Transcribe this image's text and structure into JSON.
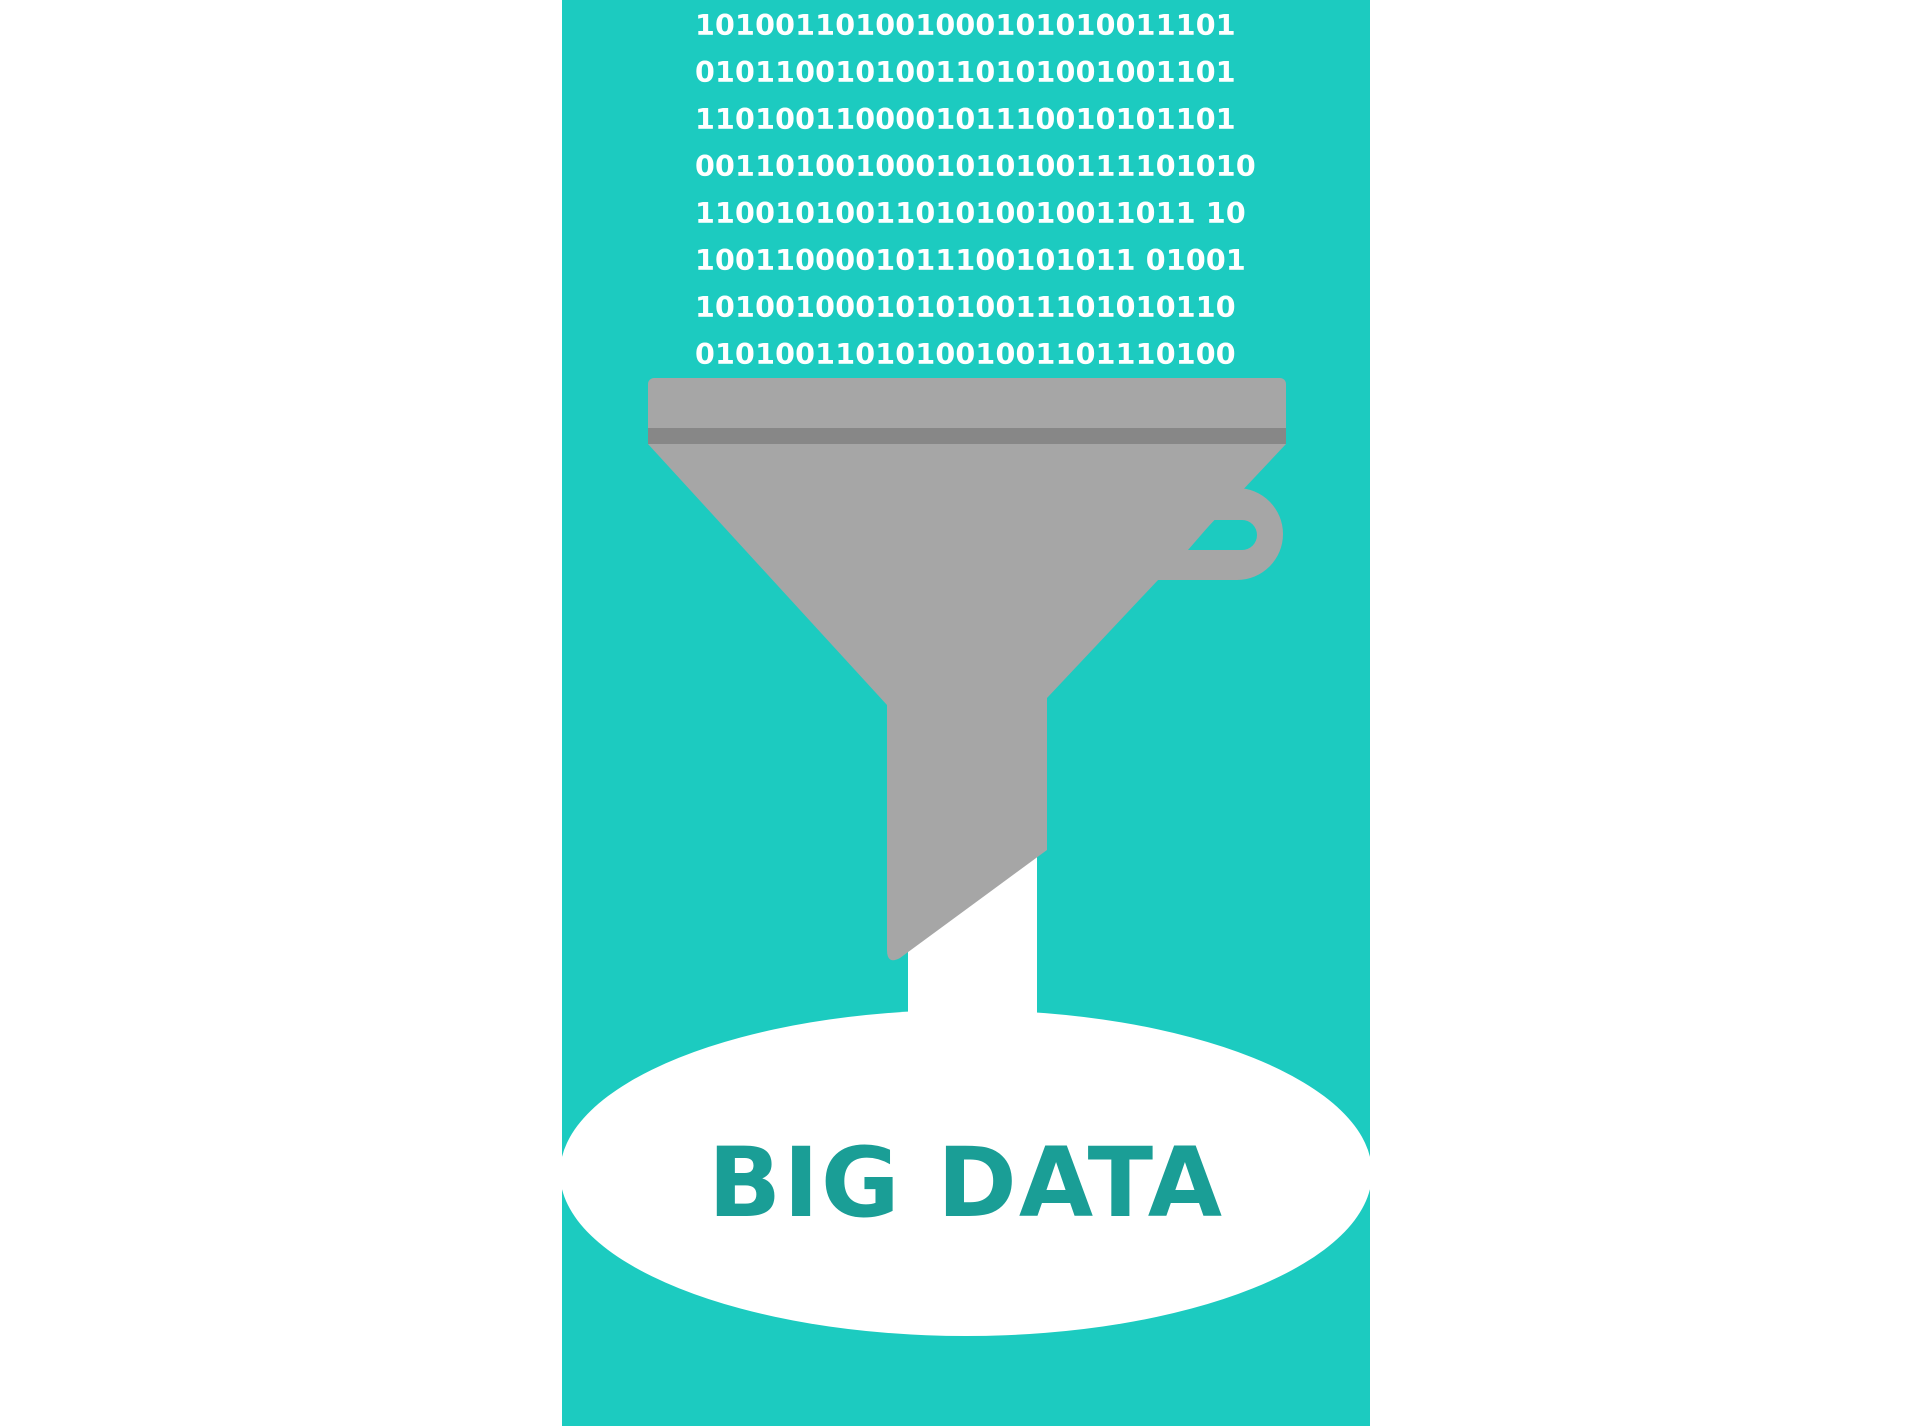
{
  "binary_lines": [
    "101001101001000101010011101",
    "010110010100110101001001101",
    "110100110000101110010101101",
    "0011010010001010100111101010",
    "1100101001101010010011011 10",
    "1001100001011100101011 01001",
    "101001000101010011101010110",
    "010100110101001001101110100"
  ],
  "label": "BIG DATA",
  "colors": {
    "background": "#ffffff",
    "panel": "#1ccbc0",
    "funnel": "#a6a6a6",
    "funnel_band": "#878787",
    "label_primary": "#1a9e96",
    "label_highlight": "#5fc3bd",
    "pool": "#ffffff"
  },
  "icons": {
    "funnel": "funnel-icon"
  }
}
